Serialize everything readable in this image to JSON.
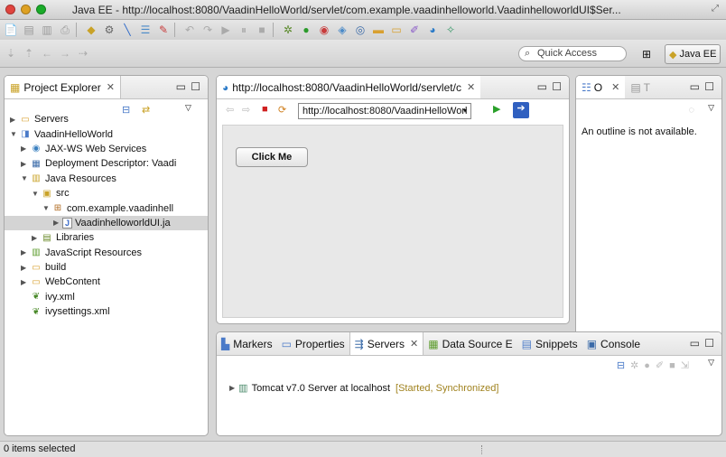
{
  "window": {
    "title": "Java EE - http://localhost:8080/VaadinHelloWorld/servlet/com.example.vaadinhelloworld.VaadinhelloworldUI$Ser...",
    "close_color": "#e0443e",
    "min_color": "#dea123",
    "max_color": "#1aab29"
  },
  "toolbar": {
    "quick_access_placeholder": "Quick Access",
    "perspective_label": "Java EE"
  },
  "project_explorer": {
    "title": "Project Explorer",
    "items": [
      {
        "label": "Servers",
        "indent": 0,
        "expanded": false,
        "icon": "folder-icon"
      },
      {
        "label": "VaadinHelloWorld",
        "indent": 0,
        "expanded": true,
        "icon": "project-icon"
      },
      {
        "label": "JAX-WS Web Services",
        "indent": 1,
        "expanded": false,
        "icon": "webservice-icon"
      },
      {
        "label": "Deployment Descriptor: Vaadi",
        "indent": 1,
        "expanded": false,
        "icon": "descriptor-icon"
      },
      {
        "label": "Java Resources",
        "indent": 1,
        "expanded": true,
        "icon": "java-resources-icon"
      },
      {
        "label": "src",
        "indent": 2,
        "expanded": true,
        "icon": "source-folder-icon"
      },
      {
        "label": "com.example.vaadinhell",
        "indent": 3,
        "expanded": true,
        "icon": "package-icon"
      },
      {
        "label": "VaadinhelloworldUI.ja",
        "indent": 4,
        "expanded": false,
        "icon": "java-file-icon",
        "selected": true
      },
      {
        "label": "Libraries",
        "indent": 2,
        "expanded": false,
        "icon": "library-icon"
      },
      {
        "label": "JavaScript Resources",
        "indent": 1,
        "expanded": false,
        "icon": "js-resources-icon"
      },
      {
        "label": "build",
        "indent": 1,
        "expanded": false,
        "icon": "folder-icon"
      },
      {
        "label": "WebContent",
        "indent": 1,
        "expanded": false,
        "icon": "folder-icon"
      },
      {
        "label": "ivy.xml",
        "indent": 1,
        "leaf": true,
        "icon": "ivy-icon"
      },
      {
        "label": "ivysettings.xml",
        "indent": 1,
        "leaf": true,
        "icon": "ivy-icon"
      }
    ]
  },
  "browser": {
    "tab_title": "http://localhost:8080/VaadinHelloWorld/servlet/c",
    "url": "http://localhost:8080/VaadinHelloWorl",
    "button_label": "Click Me"
  },
  "outline": {
    "tab1": "O",
    "tab2": "T",
    "message": "An outline is not available."
  },
  "servers_view": {
    "tabs": [
      "Markers",
      "Properties",
      "Servers",
      "Data Source E",
      "Snippets",
      "Console"
    ],
    "server_name": "Tomcat v7.0 Server at localhost",
    "server_status": "[Started, Synchronized]",
    "status_color": "#a0821e"
  },
  "statusbar": {
    "text": "0 items selected"
  }
}
